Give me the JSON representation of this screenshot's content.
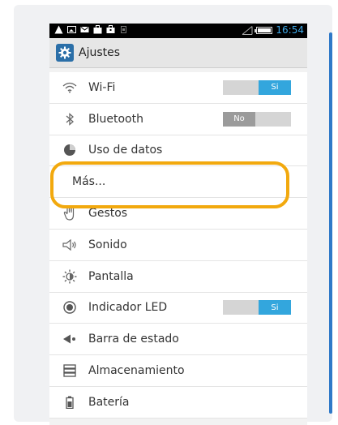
{
  "statusbar": {
    "time": "16:54",
    "left_icons": [
      "warning-icon",
      "image-icon",
      "mail-icon",
      "store-icon",
      "briefcase-icon",
      "sim-icon"
    ]
  },
  "actionbar": {
    "title": "Ajustes",
    "icon": "settings-icon"
  },
  "settings": {
    "items": [
      {
        "label": "Wi-Fi",
        "icon": "wifi-icon",
        "toggle": "Si"
      },
      {
        "label": "Bluetooth",
        "icon": "bluetooth-icon",
        "toggle": "No"
      },
      {
        "label": "Uso de datos",
        "icon": "data-usage-icon"
      },
      {
        "label": "Más..."
      },
      {
        "label": "Gestos",
        "icon": "gesture-hand-icon"
      },
      {
        "label": "Sonido",
        "icon": "speaker-icon"
      },
      {
        "label": "Pantalla",
        "icon": "brightness-icon"
      },
      {
        "label": "Indicador LED",
        "icon": "led-indicator-icon",
        "toggle": "Si"
      },
      {
        "label": "Barra de estado",
        "icon": "status-bar-icon"
      },
      {
        "label": "Almacenamiento",
        "icon": "storage-icon"
      },
      {
        "label": "Batería",
        "icon": "battery-icon"
      }
    ]
  },
  "colors": {
    "accent": "#33a6dd",
    "highlight": "#f2a90e",
    "statusbar_bg": "#000000",
    "time_text": "#3fa9e8"
  }
}
